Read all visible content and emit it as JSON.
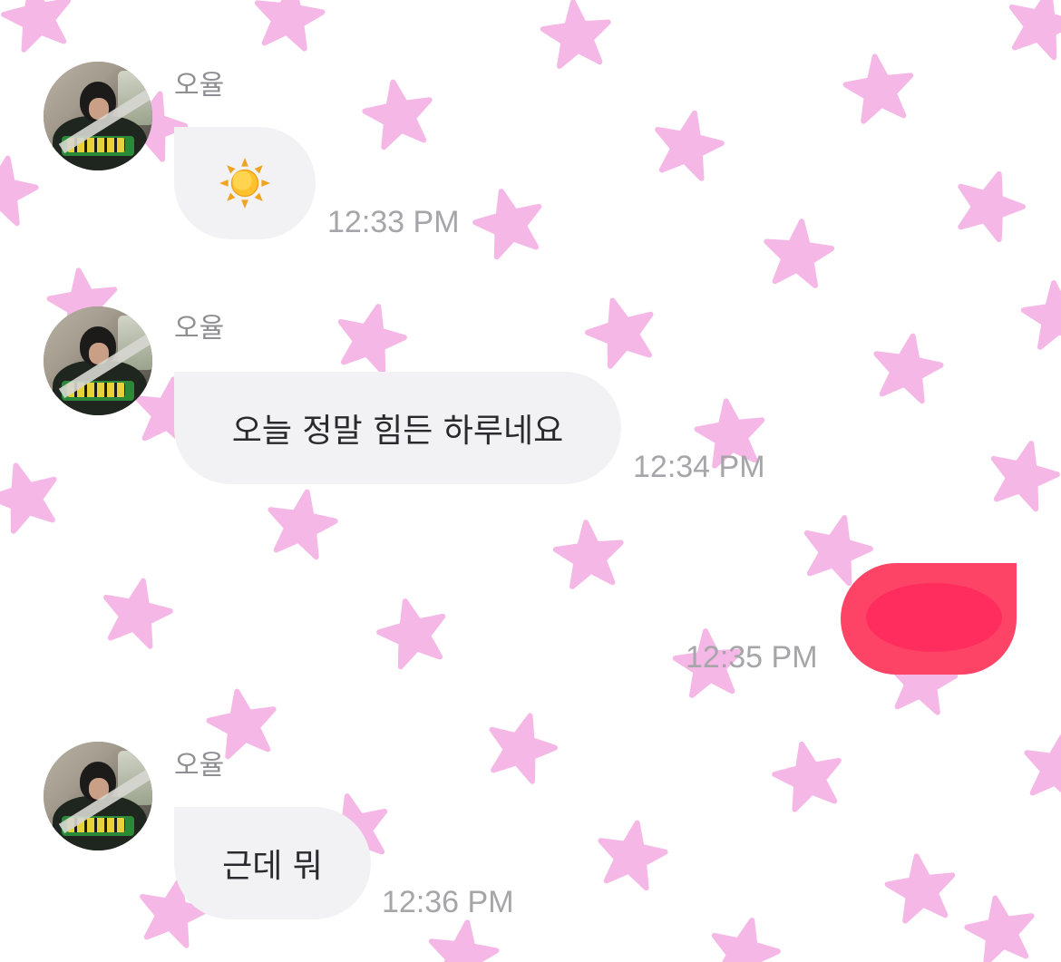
{
  "theme": {
    "background": "#ffffff",
    "star_color": "#f5b8e6",
    "received_bubble": "#f2f2f5",
    "sent_bubble": "#fe4466",
    "sent_scribble": "#ff2d5d",
    "name_color": "#8e8e93",
    "time_color": "#a6a6aa"
  },
  "messages": [
    {
      "sender": "오율",
      "type": "emoji",
      "icon": "sun-icon",
      "time": "12:33 PM"
    },
    {
      "sender": "오율",
      "type": "text",
      "text": "오늘 정말 힘든 하루네요",
      "time": "12:34 PM"
    },
    {
      "direction": "sent",
      "type": "redacted",
      "time": "12:35 PM"
    },
    {
      "sender": "오율",
      "type": "text",
      "text": "근데 뭐",
      "time": "12:36 PM"
    }
  ]
}
